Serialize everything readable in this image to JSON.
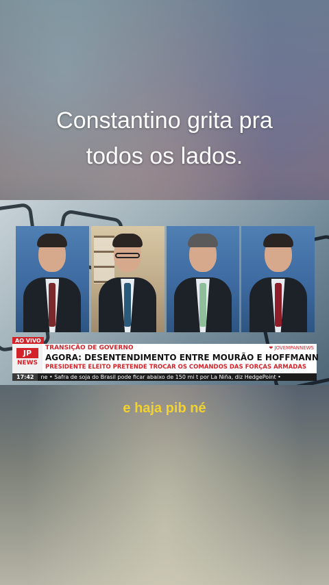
{
  "top_caption": [
    "Constantino grita pra",
    "todos os lados."
  ],
  "bottom_caption": "e haja pib né",
  "broadcast": {
    "live_tag": "AO VIVO",
    "logo_top": "JP",
    "logo_bottom": "NEWS",
    "topic": "TRANSIÇÃO DE GOVERNO",
    "brand": "❤ JOVEMPANNEWS",
    "headline": "AGORA: DESENTENDIMENTO ENTRE MOURÃO E HOFFMANN",
    "subheadline": "PRESIDENTE ELEITO PRETENDE TROCAR OS COMANDOS DAS FORÇAS ARMADAS",
    "ticker_time": "17:42",
    "ticker_text": "ne • Safra de soja do Brasil pode ficar abaixo de 150 mi t por La Niña, diz HedgePoint •"
  },
  "panel_tie_colors": [
    "#7a2a2a",
    "#2a5a7a",
    "#8fbf9a",
    "#8e1f2a"
  ]
}
